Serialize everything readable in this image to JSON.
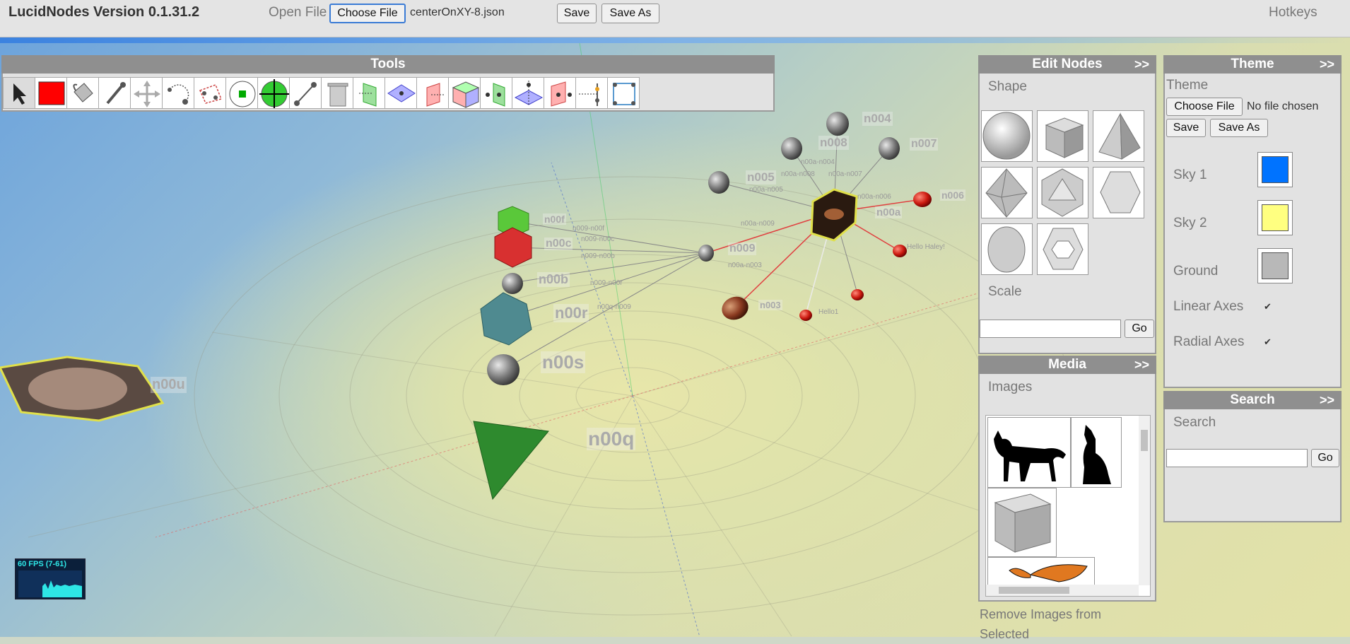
{
  "app": {
    "title": "LucidNodes Version 0.1.31.2"
  },
  "topbar": {
    "open_file_label": "Open File",
    "choose_file_button": "Choose File",
    "file_name": "centerOnXY-8.json",
    "save_button": "Save",
    "save_as_button": "Save As",
    "hotkeys_label": "Hotkeys"
  },
  "tools": {
    "title": "Tools",
    "items": [
      {
        "icon": "select-arrow-icon"
      },
      {
        "icon": "red-color-swatch-icon",
        "color": "#ff0000"
      },
      {
        "icon": "paint-bucket-icon"
      },
      {
        "icon": "eyedropper-icon"
      },
      {
        "icon": "move-arrows-icon"
      },
      {
        "icon": "rotate-node-icon"
      },
      {
        "icon": "select-group-icon"
      },
      {
        "icon": "add-node-icon"
      },
      {
        "icon": "add-node-crosshair-icon"
      },
      {
        "icon": "connect-link-icon"
      },
      {
        "icon": "trash-icon"
      },
      {
        "icon": "plane-yz-icon"
      },
      {
        "icon": "plane-xz-icon"
      },
      {
        "icon": "plane-xy-icon"
      },
      {
        "icon": "cube-planes-icon"
      },
      {
        "icon": "align-yz-icon"
      },
      {
        "icon": "align-xz-icon"
      },
      {
        "icon": "align-xy-icon"
      },
      {
        "icon": "distribute-icon"
      },
      {
        "icon": "group-nodes-icon"
      }
    ]
  },
  "edit_nodes": {
    "title": "Edit Nodes",
    "toggle": ">>",
    "shape_label": "Shape",
    "shapes": [
      "sphere",
      "cube",
      "tetrahedron",
      "octahedron",
      "icosahedron",
      "hexagon",
      "disc",
      "hexagon-ring"
    ],
    "scale_label": "Scale",
    "scale_value": "",
    "go_button": "Go"
  },
  "media": {
    "title": "Media",
    "toggle": ">>",
    "images_label": "Images",
    "images": [
      "cat-silhouette",
      "wolf-howling-silhouette",
      "cube-image",
      "butterfly-image"
    ],
    "remove_label": "Remove Images from Selected"
  },
  "theme": {
    "title": "Theme",
    "toggle": ">>",
    "theme_label": "Theme",
    "choose_file_button": "Choose File",
    "no_file_text": "No file chosen",
    "save_button": "Save",
    "save_as_button": "Save As",
    "sky1_label": "Sky 1",
    "sky1_color": "#0073ff",
    "sky2_label": "Sky 2",
    "sky2_color": "#ffff80",
    "ground_label": "Ground",
    "ground_color": "#b8b8b8",
    "linear_axes_label": "Linear Axes",
    "linear_axes_checked": true,
    "radial_axes_label": "Radial Axes",
    "radial_axes_checked": true
  },
  "search": {
    "title": "Search",
    "toggle": ">>",
    "search_label": "Search",
    "value": "",
    "go_button": "Go"
  },
  "scene": {
    "node_labels": [
      "n004",
      "n008",
      "n007",
      "n005",
      "n006",
      "n00f",
      "n00c",
      "n009",
      "n00a",
      "n00b",
      "n00r",
      "n003",
      "n00s",
      "n00u",
      "n00q"
    ],
    "edge_labels": [
      "n00a-n004",
      "n00a-n008",
      "n00a-n007",
      "n00a-n005",
      "n00a-n006",
      "n00a-n009",
      "n009-n00f",
      "n009-n00c",
      "n009-n00b",
      "n009-n00r",
      "n00q-n009",
      "n00a-n003",
      "Hello Haley!",
      "Hello1"
    ]
  },
  "fps": {
    "text": "60 FPS (7-61)"
  }
}
